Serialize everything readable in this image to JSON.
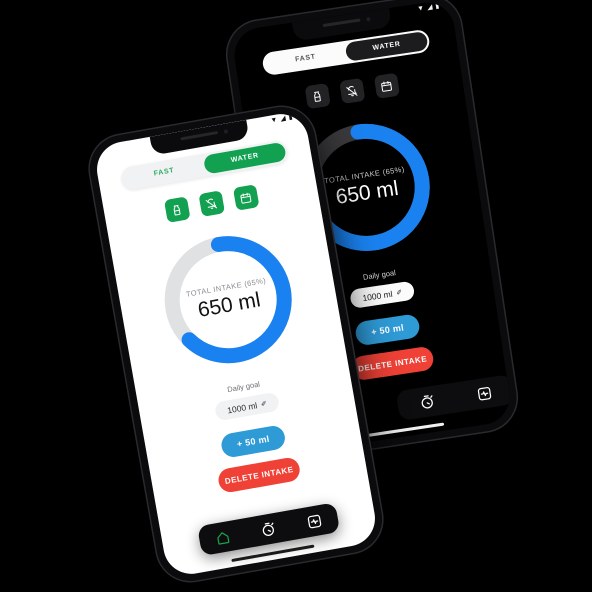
{
  "app": {
    "tabs": [
      {
        "label": "FAST",
        "active": false
      },
      {
        "label": "WATER",
        "active": true
      }
    ],
    "quick_actions": [
      {
        "name": "water-bottle-icon",
        "label": "Add drink"
      },
      {
        "name": "bell-off-icon",
        "label": "Mute reminders"
      },
      {
        "name": "calendar-icon",
        "label": "History"
      }
    ],
    "progress": {
      "label": "TOTAL INTAKE (65%)",
      "value": "650 ml",
      "percent": 65,
      "track_color_light": "#e0e1e3",
      "track_color_dark": "#3a3a3c",
      "progress_color": "#1a82f0"
    },
    "goal": {
      "label": "Daily goal",
      "value": "1000 ml",
      "edit_icon": "✐"
    },
    "buttons": {
      "add": {
        "label": "+ 50 ml",
        "color": "#2e9ad6"
      },
      "delete": {
        "label": "DELETE INTAKE",
        "color": "#ef4136"
      }
    },
    "nav": [
      {
        "name": "home-icon",
        "label": "Home",
        "active": true
      },
      {
        "name": "timer-icon",
        "label": "Fasting timer",
        "active": false
      },
      {
        "name": "activity-icon",
        "label": "Statistics",
        "active": false
      }
    ],
    "statusbar": {
      "wifi": "▼",
      "signal": "◢",
      "battery": "▮"
    }
  },
  "theme": {
    "accent_green": "#12a150",
    "accent_blue": "#1a82f0",
    "accent_red": "#ef4136",
    "background": "#000000"
  }
}
